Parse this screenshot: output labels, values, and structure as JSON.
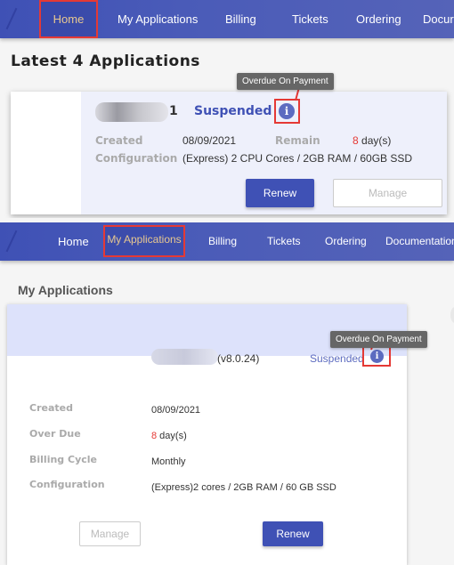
{
  "top_view": {
    "nav": {
      "items": [
        {
          "label": "Home",
          "active": true,
          "highlighted": true
        },
        {
          "label": "My Applications",
          "active": false
        },
        {
          "label": "Billing",
          "active": false
        },
        {
          "label": "Tickets",
          "active": false
        },
        {
          "label": "Ordering",
          "active": false
        },
        {
          "label": "Docur",
          "active": false
        }
      ]
    },
    "heading": "Latest 4 Applications",
    "card": {
      "name_suffix": "1",
      "status": "Suspended",
      "tooltip": "Overdue On Payment",
      "info_icon": "info-icon",
      "created_label": "Created",
      "created_value": "08/09/2021",
      "remain_label": "Remain",
      "remain_number": "8",
      "remain_unit": " day(s)",
      "config_label": "Configuration",
      "config_value": "(Express) 2 CPU Cores / 2GB RAM / 60GB SSD",
      "renew_label": "Renew",
      "manage_label": "Manage"
    }
  },
  "bottom_view": {
    "nav": {
      "items": [
        {
          "label": "Home",
          "active": false
        },
        {
          "label": "My Applications",
          "active": true,
          "highlighted": true
        },
        {
          "label": "Billing",
          "active": false
        },
        {
          "label": "Tickets",
          "active": false
        },
        {
          "label": "Ordering",
          "active": false
        },
        {
          "label": "Documentation",
          "active": false
        }
      ]
    },
    "heading": "My Applications",
    "card": {
      "version": "(v8.0.24)",
      "status": "Suspended",
      "tooltip": "Overdue On Payment",
      "info_icon": "info-icon",
      "rows": [
        {
          "label": "Created",
          "value": "08/09/2021"
        },
        {
          "label": "Over Due",
          "value_number": "8",
          "value": " day(s)"
        },
        {
          "label": "Billing Cycle",
          "value": "Monthly"
        },
        {
          "label": "Configuration",
          "value": "(Express)2 cores / 2GB RAM / 60 GB SSD"
        }
      ],
      "manage_label": "Manage",
      "renew_label": "Renew"
    }
  },
  "colors": {
    "nav_bg": "#3f51b5",
    "active_nav_text": "#e8c890",
    "highlight_box": "#e53935",
    "status_text": "#3f51b5",
    "overdue_number": "#e53935"
  }
}
